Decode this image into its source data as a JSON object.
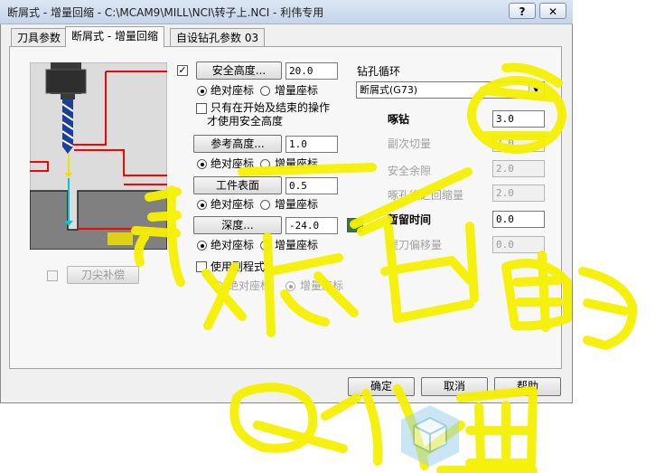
{
  "window": {
    "title": "断屑式 - 增量回缩 - C:\\MCAM9\\MILL\\NCI\\转子上.NCI - 利伟专用",
    "help_btn": "?",
    "close_btn": "✕"
  },
  "tabs": [
    {
      "label": "刀具参数",
      "active": false
    },
    {
      "label": "断屑式 - 增量回缩",
      "active": true
    },
    {
      "label": "自设钻孔参数 03",
      "active": false
    }
  ],
  "left": {
    "tip_comp_label": "刀尖补偿"
  },
  "middle": {
    "safety": {
      "checked": "✓",
      "button": "安全高度...",
      "value": "20.0"
    },
    "safety_coord": {
      "abs": "绝对座标",
      "inc": "增量座标"
    },
    "safety_only": {
      "label_line1": "只有在开始及结束的操作",
      "label_line2": "才使用安全高度"
    },
    "retract": {
      "button": "参考高度...",
      "value": "1.0"
    },
    "retract_coord": {
      "abs": "绝对座标",
      "inc": "增量座标"
    },
    "top": {
      "button": "工件表面",
      "value": "0.5"
    },
    "top_coord": {
      "abs": "绝对座标",
      "inc": "增量座标"
    },
    "depth": {
      "button": "深度...",
      "value": "-24.0"
    },
    "depth_coord": {
      "abs": "绝对座标",
      "inc": "增量座标"
    },
    "subprogram": {
      "label": "使用副程式"
    },
    "sub_coord": {
      "abs": "绝对座标",
      "inc": "增量座标"
    }
  },
  "right": {
    "cycle_label": "钻孔循环",
    "cycle_value": "断屑式(G73)",
    "fields": [
      {
        "label": "啄钻",
        "value": "3.0",
        "enabled": true
      },
      {
        "label": "副次切量",
        "value": "2.0",
        "enabled": false
      },
      {
        "label": "安全余隙",
        "value": "2.0",
        "enabled": false
      },
      {
        "label": "啄孔後之回缩量",
        "value": "2.0",
        "enabled": false
      },
      {
        "label": "暂留时间",
        "value": "0.0",
        "enabled": true
      },
      {
        "label": "提刀偏移量",
        "value": "0.0",
        "enabled": false
      }
    ]
  },
  "footer": {
    "ok": "确定",
    "cancel": "取消",
    "help": "帮助"
  },
  "colors": {
    "scribble": "#f5f000",
    "toolpath": "#ff0000",
    "stock": "#808080"
  }
}
